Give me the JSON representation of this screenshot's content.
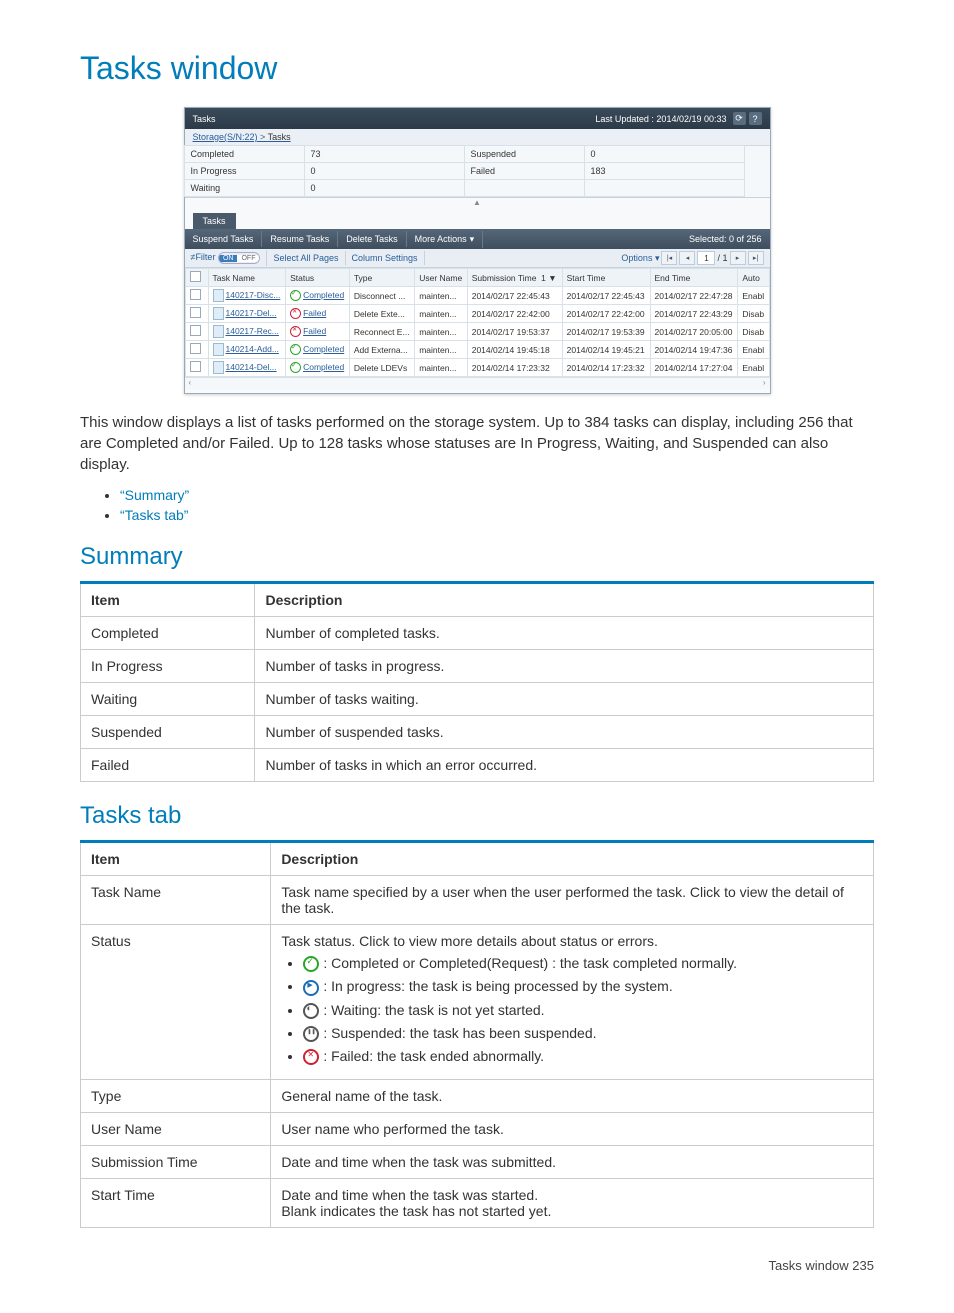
{
  "page": {
    "title": "Tasks window",
    "footer": "Tasks window   235"
  },
  "screenshot": {
    "header": {
      "title": "Tasks",
      "last_updated": "Last Updated : 2014/02/19 00:33"
    },
    "breadcrumb": {
      "root": "Storage(S/N:22)",
      "sep": " > ",
      "leaf": "Tasks"
    },
    "summary": {
      "completed_label": "Completed",
      "completed_value": "73",
      "inprogress_label": "In Progress",
      "inprogress_value": "0",
      "waiting_label": "Waiting",
      "waiting_value": "0",
      "suspended_label": "Suspended",
      "suspended_value": "0",
      "failed_label": "Failed",
      "failed_value": "183"
    },
    "tab_label": "Tasks",
    "toolbar": {
      "suspend": "Suspend Tasks",
      "resume": "Resume Tasks",
      "delete": "Delete Tasks",
      "more": "More Actions",
      "selected": "Selected:  0  of  256"
    },
    "subtoolbar": {
      "filter": "≠Filter",
      "on": "ON",
      "off": "OFF",
      "select_all": "Select All Pages",
      "columns": "Column Settings",
      "options": "Options",
      "page": "1",
      "of": "/ 1"
    },
    "columns": {
      "task_name": "Task Name",
      "status": "Status",
      "type": "Type",
      "user_name": "User Name",
      "submission_time": "Submission Time",
      "sort_ind": "1 ▼",
      "start_time": "Start Time",
      "end_time": "End Time",
      "auto": "Auto"
    },
    "rows": [
      {
        "name": "140217-Disc...",
        "status": "Completed",
        "status_type": "completed",
        "type": "Disconnect ...",
        "user": "mainten...",
        "sub": "2014/02/17 22:45:43",
        "start": "2014/02/17 22:45:43",
        "end": "2014/02/17 22:47:28",
        "auto": "Enabl"
      },
      {
        "name": "140217-Del...",
        "status": "Failed",
        "status_type": "failed",
        "type": "Delete Exte...",
        "user": "mainten...",
        "sub": "2014/02/17 22:42:00",
        "start": "2014/02/17 22:42:00",
        "end": "2014/02/17 22:43:29",
        "auto": "Disab"
      },
      {
        "name": "140217-Rec...",
        "status": "Failed",
        "status_type": "failed",
        "type": "Reconnect E...",
        "user": "mainten...",
        "sub": "2014/02/17 19:53:37",
        "start": "2014/02/17 19:53:39",
        "end": "2014/02/17 20:05:00",
        "auto": "Disab"
      },
      {
        "name": "140214-Add...",
        "status": "Completed",
        "status_type": "completed",
        "type": "Add Externa...",
        "user": "mainten...",
        "sub": "2014/02/14 19:45:18",
        "start": "2014/02/14 19:45:21",
        "end": "2014/02/14 19:47:36",
        "auto": "Enabl"
      },
      {
        "name": "140214-Del...",
        "status": "Completed",
        "status_type": "completed",
        "type": "Delete LDEVs",
        "user": "mainten...",
        "sub": "2014/02/14 17:23:32",
        "start": "2014/02/14 17:23:32",
        "end": "2014/02/14 17:27:04",
        "auto": "Enabl"
      }
    ]
  },
  "intro": "This window displays a list of tasks performed on the storage system. Up to 384 tasks can display, including 256 that are Completed and/or Failed. Up to 128 tasks whose statuses are In Progress, Waiting, and Suspended can also display.",
  "links": {
    "summary": "“Summary”",
    "tasks_tab": "“Tasks tab”"
  },
  "summary_section": {
    "heading": "Summary",
    "col_item": "Item",
    "col_desc": "Description",
    "rows": [
      {
        "item": "Completed",
        "desc": "Number of completed tasks."
      },
      {
        "item": "In Progress",
        "desc": "Number of tasks in progress."
      },
      {
        "item": "Waiting",
        "desc": "Number of tasks waiting."
      },
      {
        "item": "Suspended",
        "desc": "Number of suspended tasks."
      },
      {
        "item": "Failed",
        "desc": "Number of tasks in which an error occurred."
      }
    ]
  },
  "tasks_tab_section": {
    "heading": "Tasks tab",
    "col_item": "Item",
    "col_desc": "Description",
    "rows": {
      "task_name": {
        "item": "Task Name",
        "desc": "Task name specified by a user when the user performed the task. Click to view the detail of the task."
      },
      "status": {
        "item": "Status",
        "intro": "Task status. Click to view more details about status or errors.",
        "completed": ": Completed or Completed(Request) : the task completed normally.",
        "inprogress": ": In progress: the task is being processed by the system.",
        "waiting": ": Waiting: the task is not yet started.",
        "suspended": ": Suspended: the task has been suspended.",
        "failed": ": Failed: the task ended abnormally."
      },
      "type": {
        "item": "Type",
        "desc": "General name of the task."
      },
      "user_name": {
        "item": "User Name",
        "desc": "User name who performed the task."
      },
      "submission_time": {
        "item": "Submission Time",
        "desc": "Date and time when the task was submitted."
      },
      "start_time": {
        "item": "Start Time",
        "line1": "Date and time when the task was started.",
        "line2": "Blank indicates the task has not started yet."
      }
    }
  }
}
